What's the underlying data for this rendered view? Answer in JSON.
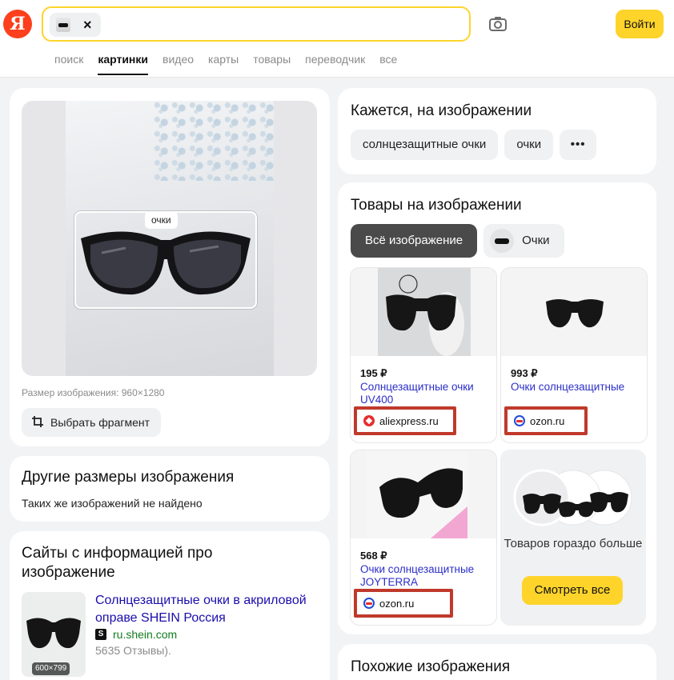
{
  "header": {
    "logo_letter": "Я",
    "search_placeholder": "",
    "chip_close": "×",
    "login_label": "Войти",
    "nav": [
      "поиск",
      "картинки",
      "видео",
      "карты",
      "товары",
      "переводчик",
      "все"
    ],
    "nav_active": "картинки"
  },
  "image_card": {
    "selection_label": "очки",
    "size_text": "Размер изображения: 960×1280",
    "fragment_button": "Выбрать фрагмент"
  },
  "other_sizes": {
    "title": "Другие размеры изображения",
    "subtitle": "Таких же изображений не найдено"
  },
  "sites": {
    "title": "Сайты с информацией про изображение",
    "thumb_badge": "600×799",
    "link_text": "Солнцезащитные очки в акриловой оправе SHEIN Россия",
    "domain_icon": "S",
    "domain": "ru.shein.com",
    "reviews": "5635 Отзывы)."
  },
  "seems": {
    "title": "Кажется, на изображении",
    "pills": [
      "солнцезащитные очки",
      "очки"
    ],
    "more_label": "•••"
  },
  "products": {
    "title": "Товары на изображении",
    "tab_all": "Всё изображение",
    "tab_glasses": "Очки",
    "items": [
      {
        "price": "195 ₽",
        "name": "Солнцезащитные очки UV400",
        "shop": "aliexpress.ru",
        "shop_icon": "aliexpress-icon"
      },
      {
        "price": "993 ₽",
        "name": "Очки солнцезащитные",
        "shop": "ozon.ru",
        "shop_icon": "ozon-icon"
      },
      {
        "price": "568 ₽",
        "name": "Очки солнцезащитные JOYTERRA",
        "shop": "ozon.ru",
        "shop_icon": "ozon-icon"
      }
    ],
    "more_text": "Товаров гораздо больше",
    "more_button": "Смотреть все"
  },
  "similar": {
    "title": "Похожие изображения"
  },
  "colors": {
    "accent_yellow": "#fed42b",
    "logo_red": "#fc3f1d",
    "link_blue": "#2b2ec7",
    "highlight_red": "#c0392b"
  }
}
